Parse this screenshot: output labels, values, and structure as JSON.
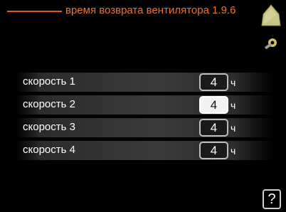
{
  "header": {
    "title": "время возврата вентилятора 1.9.6"
  },
  "icons": {
    "house": "house-icon",
    "tool": "service-tool-icon"
  },
  "rows": [
    {
      "label": "скорость 1",
      "value": "4",
      "unit": "ч",
      "selected": false
    },
    {
      "label": "скорость 2",
      "value": "4",
      "unit": "ч",
      "selected": true
    },
    {
      "label": "скорость 3",
      "value": "4",
      "unit": "ч",
      "selected": false
    },
    {
      "label": "скорость 4",
      "value": "4",
      "unit": "ч",
      "selected": false
    }
  ],
  "help": {
    "label": "?"
  },
  "colors": {
    "accent": "#e8742c",
    "background": "#000000",
    "house": "#c9c488"
  }
}
